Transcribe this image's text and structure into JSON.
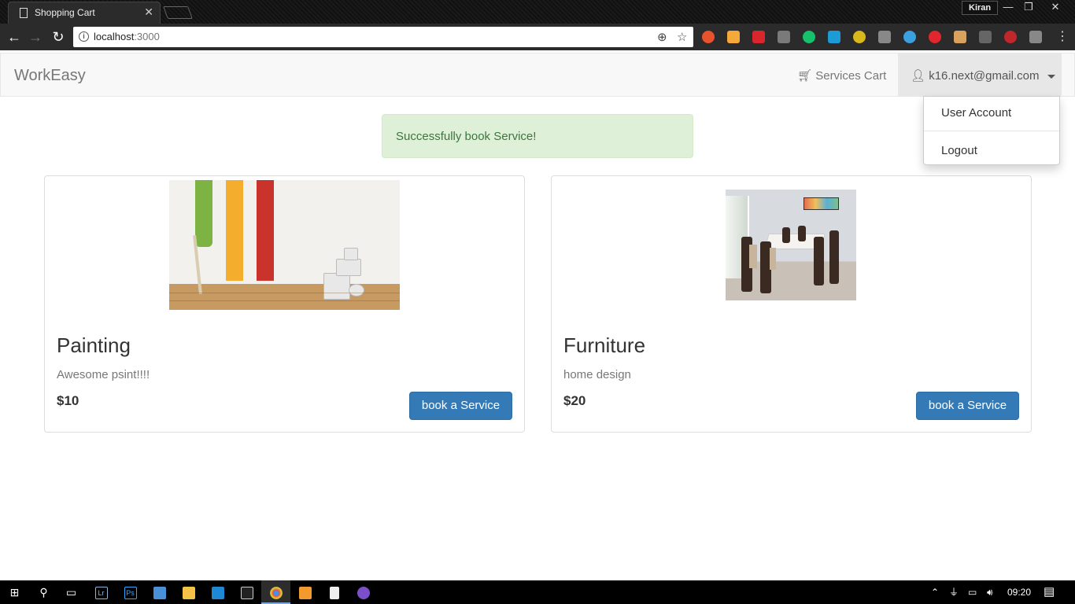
{
  "browser": {
    "tab_title": "Shopping Cart",
    "profile_name": "Kiran",
    "url_host": "localhost",
    "url_port": ":3000"
  },
  "navbar": {
    "brand": "WorkEasy",
    "cart_label": "Services Cart",
    "user_email": "k16.next@gmail.com"
  },
  "dropdown": {
    "items": [
      "User Account",
      "Logout"
    ]
  },
  "alert": {
    "message": "Successfully book Service!",
    "color": "#3c763d"
  },
  "services": [
    {
      "title": "Painting",
      "description": "Awesome psint!!!!",
      "price": "$10",
      "button": "book a Service",
      "image": "painting-image"
    },
    {
      "title": "Furniture",
      "description": "home design",
      "price": "$20",
      "button": "book a Service",
      "image": "furniture-image"
    }
  ],
  "taskbar": {
    "time": "09:20",
    "apps": [
      "windows-start-icon",
      "search-icon",
      "task-view-icon",
      "lightroom-icon",
      "photoshop-icon",
      "app-icon",
      "file-explorer-icon",
      "vscode-icon",
      "terminal-icon",
      "chrome-icon",
      "sublime-text-icon",
      "file-icon",
      "app-purple-icon"
    ]
  },
  "colors": {
    "primary_button": "#337ab7",
    "alert_bg": "#dff0d8",
    "navbar_bg": "#f8f8f8"
  }
}
